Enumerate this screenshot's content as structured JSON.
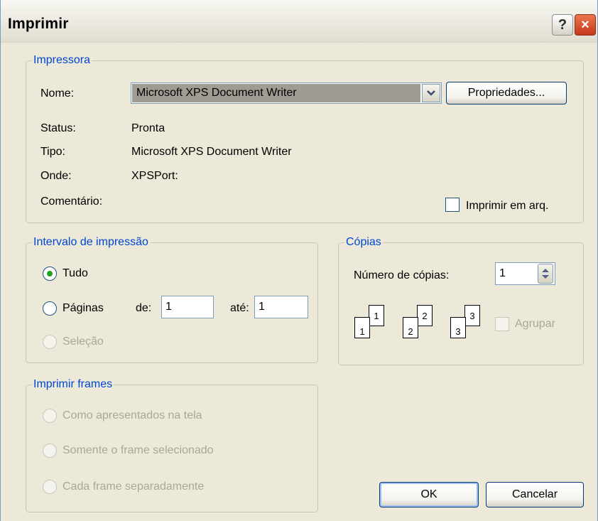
{
  "window": {
    "title": "Imprimir",
    "help_label": "?",
    "close_label": "×"
  },
  "printer": {
    "legend": "Impressora",
    "name_label": "Nome:",
    "name_value": "Microsoft XPS Document Writer",
    "properties_button": "Propriedades...",
    "status_label": "Status:",
    "status_value": "Pronta",
    "type_label": "Tipo:",
    "type_value": "Microsoft XPS Document Writer",
    "where_label": "Onde:",
    "where_value": "XPSPort:",
    "comment_label": "Comentário:",
    "print_to_file_label": "Imprimir em arq."
  },
  "range": {
    "legend": "Intervalo de impressão",
    "all_label": "Tudo",
    "pages_label": "Páginas",
    "from_label": "de:",
    "from_value": "1",
    "to_label": "até:",
    "to_value": "1",
    "selection_label": "Seleção"
  },
  "copies": {
    "legend": "Cópias",
    "count_label": "Número de cópias:",
    "count_value": "1",
    "collate_label": "Agrupar",
    "page_numbers": [
      "1",
      "1",
      "2",
      "2",
      "3",
      "3"
    ]
  },
  "frames": {
    "legend": "Imprimir frames",
    "as_shown_label": "Como apresentados na tela",
    "selected_label": "Somente o frame selecionado",
    "separately_label": "Cada frame separadamente"
  },
  "buttons": {
    "ok": "OK",
    "cancel": "Cancelar"
  },
  "colors": {
    "accent_blue": "#0046D5",
    "dialog_bg": "#ECE9D8",
    "radio_dot": "#21A121"
  }
}
